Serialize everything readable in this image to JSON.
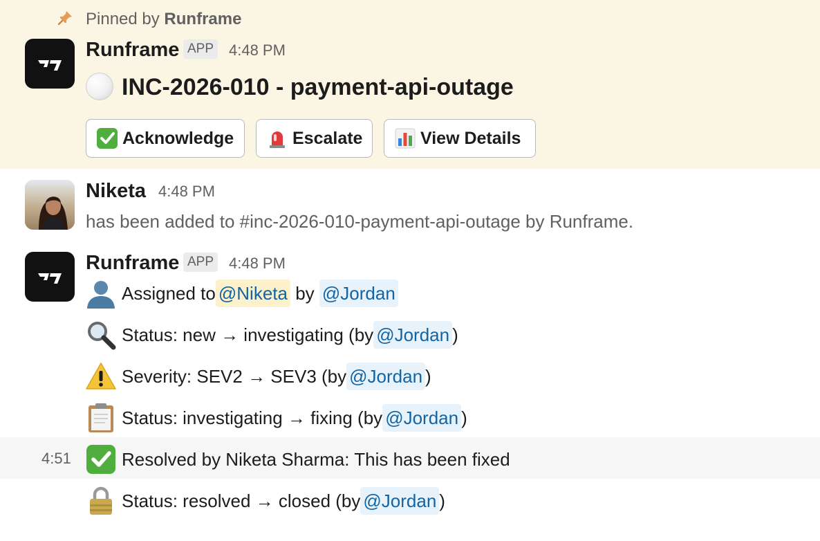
{
  "pinned": {
    "prefix": "Pinned by ",
    "by": "Runframe"
  },
  "message1": {
    "sender": "Runframe",
    "badge": "APP",
    "time": "4:48 PM",
    "title": "INC-2026-010 - payment-api-outage",
    "buttons": {
      "acknowledge": "Acknowledge",
      "escalate": "Escalate",
      "view_details": "View Details"
    }
  },
  "message2": {
    "sender": "Niketa",
    "time": "4:48 PM",
    "text": "has been added to #inc-2026-010-payment-api-outage by Runframe."
  },
  "message3": {
    "sender": "Runframe",
    "badge": "APP",
    "time": "4:48 PM",
    "assigned": {
      "prefix": "Assigned to ",
      "assignee": "@Niketa",
      "middle": " by ",
      "by": "@Jordan"
    },
    "status1": {
      "text": "Status: new → investigating (by ",
      "by": "@Jordan",
      "suffix": ")"
    },
    "severity": {
      "text": "Severity: SEV2 → SEV3 (by ",
      "by": "@Jordan",
      "suffix": ")"
    },
    "status2": {
      "text": "Status: investigating → fixing (by ",
      "by": "@Jordan",
      "suffix": ")"
    },
    "resolved": {
      "time": "4:51",
      "text": "Resolved by Niketa Sharma: This has been fixed"
    },
    "status3": {
      "text": "Status: resolved → closed (by ",
      "by": "@Jordan",
      "suffix": ")"
    }
  },
  "colors": {
    "pinned_bg": "#fbf5e4",
    "mention_bg": "#e8f2fa",
    "mention_text": "#1264a3",
    "self_mention_bg": "#fdf1cc",
    "hover_bg": "#f6f6f6"
  },
  "icons": {
    "pin": "pin-icon",
    "app_logo": "runframe-logo-icon",
    "white_circle": "white-circle-icon",
    "check": "check-mark-icon",
    "siren": "siren-icon",
    "chart": "bar-chart-icon",
    "user": "bust-silhouette-icon",
    "magnifier": "magnifying-glass-icon",
    "warning": "warning-icon",
    "clipboard": "clipboard-icon",
    "lock": "lock-icon"
  }
}
